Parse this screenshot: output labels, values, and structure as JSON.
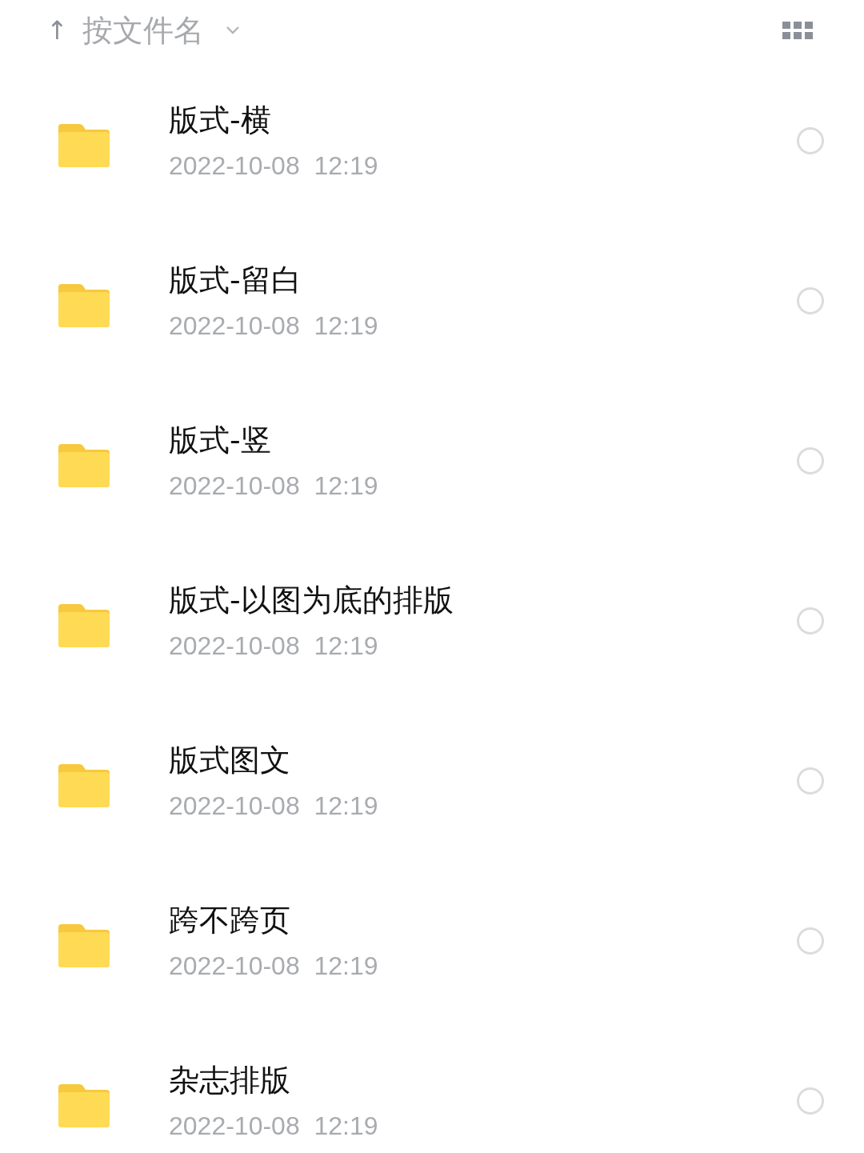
{
  "sort_bar": {
    "arrow": "↑",
    "label": "按文件名"
  },
  "files": [
    {
      "name": "版式-横",
      "date": "2022-10-08  12:19",
      "selected": false
    },
    {
      "name": "版式-留白",
      "date": "2022-10-08  12:19",
      "selected": false
    },
    {
      "name": "版式-竖",
      "date": "2022-10-08  12:19",
      "selected": false
    },
    {
      "name": "版式-以图为底的排版",
      "date": "2022-10-08  12:19",
      "selected": false
    },
    {
      "name": "版式图文",
      "date": "2022-10-08  12:19",
      "selected": false
    },
    {
      "name": "跨不跨页",
      "date": "2022-10-08  12:19",
      "selected": false
    },
    {
      "name": "杂志排版",
      "date": "2022-10-08  12:19",
      "selected": false
    }
  ]
}
